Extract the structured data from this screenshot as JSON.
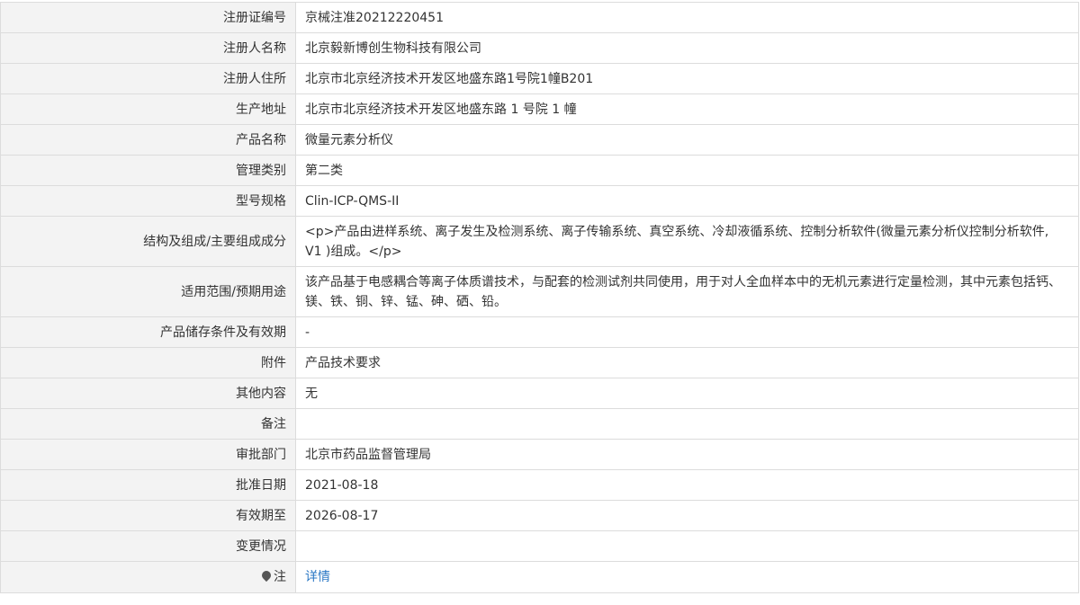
{
  "rows": [
    {
      "label": "注册证编号",
      "value": "京械注准20212220451"
    },
    {
      "label": "注册人名称",
      "value": "北京毅新博创生物科技有限公司"
    },
    {
      "label": "注册人住所",
      "value": "北京市北京经济技术开发区地盛东路1号院1幢B201"
    },
    {
      "label": "生产地址",
      "value": "北京市北京经济技术开发区地盛东路 1 号院 1 幢"
    },
    {
      "label": "产品名称",
      "value": "微量元素分析仪"
    },
    {
      "label": "管理类别",
      "value": "第二类"
    },
    {
      "label": "型号规格",
      "value": "Clin-ICP-QMS-II"
    },
    {
      "label": "结构及组成/主要组成成分",
      "value": "<p>产品由进样系统、离子发生及检测系统、离子传输系统、真空系统、冷却液循系统、控制分析软件(微量元素分析仪控制分析软件, V1 )组成。</p>"
    },
    {
      "label": "适用范围/预期用途",
      "value": "该产品基于电感耦合等离子体质谱技术，与配套的检测试剂共同使用，用于对人全血样本中的无机元素进行定量检测，其中元素包括钙、镁、铁、铜、锌、锰、砷、硒、铅。"
    },
    {
      "label": "产品储存条件及有效期",
      "value": "-"
    },
    {
      "label": "附件",
      "value": "产品技术要求"
    },
    {
      "label": "其他内容",
      "value": "无"
    },
    {
      "label": "备注",
      "value": ""
    },
    {
      "label": "审批部门",
      "value": "北京市药品监督管理局"
    },
    {
      "label": "批准日期",
      "value": "2021-08-18"
    },
    {
      "label": "有效期至",
      "value": "2026-08-17"
    },
    {
      "label": "变更情况",
      "value": ""
    }
  ],
  "note_row": {
    "icon": "pin-icon",
    "label": "注",
    "link": "详情"
  },
  "colors": {
    "label_bg": "#f3f3f3",
    "border": "#dcdcdc",
    "link": "#2b78c5"
  }
}
